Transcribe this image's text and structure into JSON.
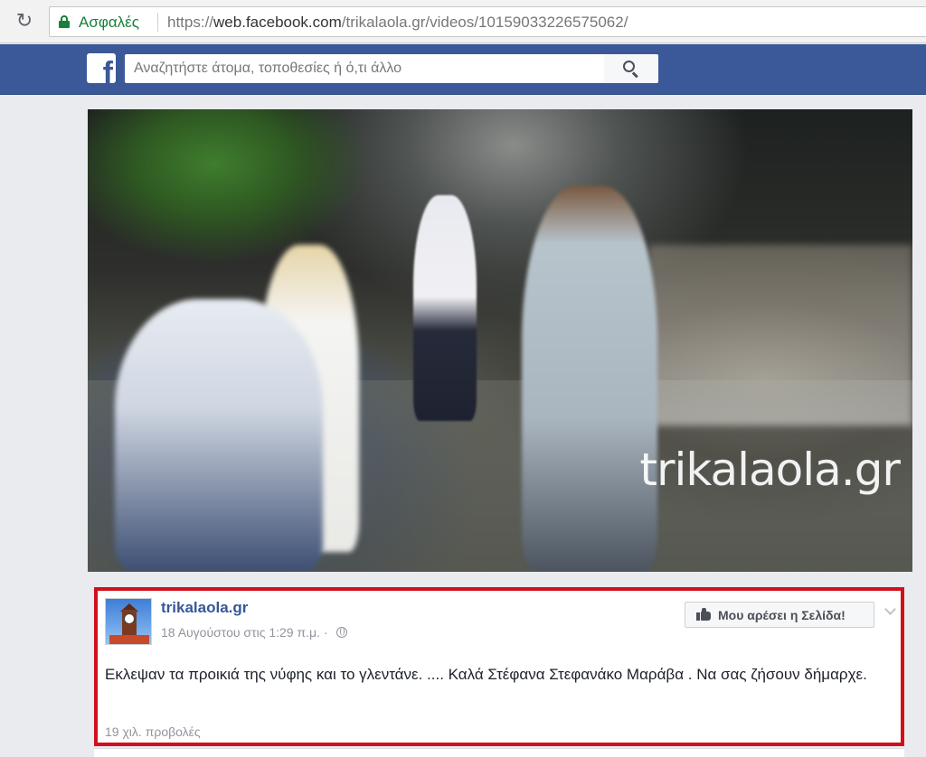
{
  "browser": {
    "secure_label": "Ασφαλές",
    "url_protocol": "https://",
    "url_host": "web.facebook.com",
    "url_path": "/trikalaola.gr/videos/10159033226575062/"
  },
  "facebook": {
    "logo": "f",
    "search_placeholder": "Αναζητήστε άτομα, τοποθεσίες ή ό,τι άλλο",
    "brand_color": "#3b5998"
  },
  "video": {
    "watermark": "trikalaola.gr"
  },
  "post": {
    "page_name": "trikalaola.gr",
    "timestamp": "18 Αυγούστου στις 1:29 π.μ.",
    "separator": "·",
    "privacy_icon": "globe-icon",
    "like_page_label": "Μου αρέσει η Σελίδα!",
    "text": "Εκλεψαν τα προικιά της νύφης και το γλεντάνε. .... Καλά Στέφανα Στεφανάκο Μαράβα . Να σας ζήσουν δήμαρχε.",
    "views": "19 χιλ. προβολές",
    "highlight_color": "#d0111c"
  }
}
